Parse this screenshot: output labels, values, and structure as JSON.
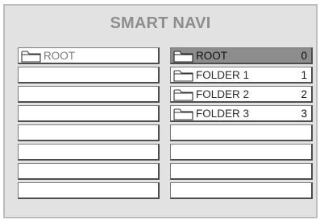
{
  "title": "SMART NAVI",
  "left_list": {
    "items": [
      {
        "label": "ROOT",
        "icon": "folder-icon"
      },
      {
        "label": ""
      },
      {
        "label": ""
      },
      {
        "label": ""
      },
      {
        "label": ""
      },
      {
        "label": ""
      },
      {
        "label": ""
      },
      {
        "label": ""
      }
    ]
  },
  "right_list": {
    "items": [
      {
        "label": "ROOT",
        "count": "0",
        "icon": "folder-icon",
        "selected": true
      },
      {
        "label": "FOLDER 1",
        "count": "1",
        "icon": "folder-icon"
      },
      {
        "label": "FOLDER 2",
        "count": "2",
        "icon": "folder-icon"
      },
      {
        "label": "FOLDER 3",
        "count": "3",
        "icon": "folder-icon"
      },
      {
        "label": "",
        "count": ""
      },
      {
        "label": "",
        "count": ""
      },
      {
        "label": "",
        "count": ""
      },
      {
        "label": "",
        "count": ""
      }
    ]
  },
  "colors": {
    "panel_background": "#e2e2e2",
    "title": "#8e8e8e",
    "selected_row": "#8d8d8d"
  }
}
